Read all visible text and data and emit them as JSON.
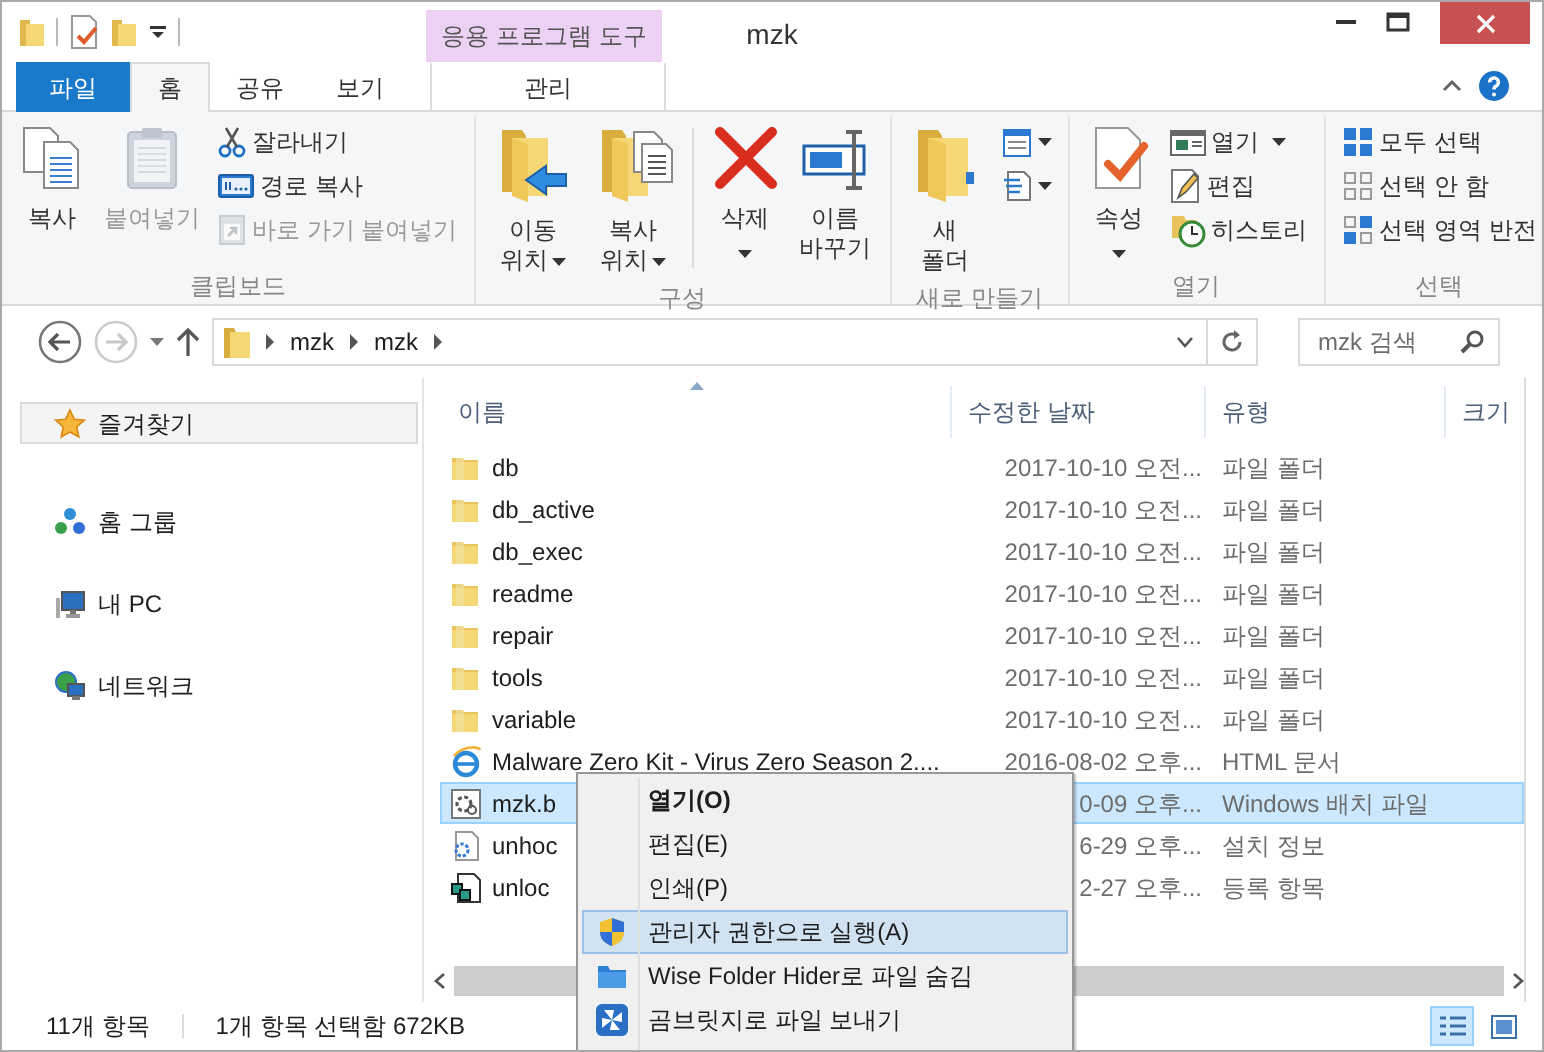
{
  "window": {
    "title": "mzk"
  },
  "contextual_tab_header": "응용 프로그램 도구",
  "ribbon_tabs": [
    {
      "label": "파일",
      "kind": "file",
      "selected": false
    },
    {
      "label": "홈",
      "kind": "tab",
      "selected": true
    },
    {
      "label": "공유",
      "kind": "tab",
      "selected": false
    },
    {
      "label": "보기",
      "kind": "tab",
      "selected": false
    },
    {
      "label": "관리",
      "kind": "contextual",
      "selected": false
    }
  ],
  "ribbon_groups": [
    {
      "label": "클립보드",
      "items": [
        {
          "kind": "large",
          "lines": [
            "복사"
          ],
          "dropdown": false,
          "disabled": false
        },
        {
          "kind": "large",
          "lines": [
            "붙여넣기"
          ],
          "dropdown": false,
          "disabled": true
        },
        {
          "kind": "column",
          "buttons": [
            {
              "label": "잘라내기",
              "dropdown": false,
              "disabled": false
            },
            {
              "label": "경로 복사",
              "dropdown": false,
              "disabled": false
            },
            {
              "label": "바로 가기 붙여넣기",
              "dropdown": false,
              "disabled": true
            }
          ]
        }
      ]
    },
    {
      "label": "구성",
      "items": [
        {
          "kind": "large",
          "lines": [
            "이동",
            "위치"
          ],
          "dropdown": true,
          "disabled": false
        },
        {
          "kind": "large",
          "lines": [
            "복사",
            "위치"
          ],
          "dropdown": true,
          "disabled": false
        },
        {
          "kind": "separator"
        },
        {
          "kind": "large",
          "lines": [
            "삭제"
          ],
          "dropdown": true,
          "disabled": false
        },
        {
          "kind": "large",
          "lines": [
            "이름",
            "바꾸기"
          ],
          "dropdown": false,
          "disabled": false
        }
      ]
    },
    {
      "label": "새로 만들기",
      "items": [
        {
          "kind": "large",
          "lines": [
            "새",
            "폴더"
          ],
          "dropdown": false,
          "disabled": false
        },
        {
          "kind": "column",
          "buttons": [
            {
              "dropdown": true,
              "disabled": false
            },
            {
              "dropdown": true,
              "disabled": false
            }
          ]
        }
      ]
    },
    {
      "label": "열기",
      "items": [
        {
          "kind": "large",
          "lines": [
            "속성"
          ],
          "dropdown": true,
          "disabled": false
        },
        {
          "kind": "column",
          "buttons": [
            {
              "label": "열기",
              "dropdown": true,
              "disabled": false
            },
            {
              "label": "편집",
              "dropdown": false,
              "disabled": false
            },
            {
              "label": "히스토리",
              "dropdown": false,
              "disabled": false
            }
          ]
        }
      ]
    },
    {
      "label": "선택",
      "items": [
        {
          "kind": "column",
          "buttons": [
            {
              "label": "모두 선택",
              "dropdown": false,
              "disabled": false
            },
            {
              "label": "선택 안 함",
              "dropdown": false,
              "disabled": false
            },
            {
              "label": "선택 영역 반전",
              "dropdown": false,
              "disabled": false
            }
          ]
        }
      ]
    }
  ],
  "address_bar": {
    "breadcrumbs": [
      "mzk",
      "mzk"
    ]
  },
  "search": {
    "placeholder": "mzk 검색"
  },
  "navigation_pane": [
    {
      "label": "즐겨찾기",
      "kind": "favorites",
      "selected": true
    },
    {
      "label": "홈 그룹",
      "kind": "homegroup",
      "selected": false
    },
    {
      "label": "내 PC",
      "kind": "pc",
      "selected": false
    },
    {
      "label": "네트워크",
      "kind": "network",
      "selected": false
    }
  ],
  "file_list": {
    "columns": [
      "이름",
      "수정한 날짜",
      "유형",
      "크기"
    ],
    "rows": [
      {
        "name": "db",
        "date": "2017-10-10 오전...",
        "type": "파일 폴더",
        "kind": "folder",
        "selected": false
      },
      {
        "name": "db_active",
        "date": "2017-10-10 오전...",
        "type": "파일 폴더",
        "kind": "folder",
        "selected": false
      },
      {
        "name": "db_exec",
        "date": "2017-10-10 오전...",
        "type": "파일 폴더",
        "kind": "folder",
        "selected": false
      },
      {
        "name": "readme",
        "date": "2017-10-10 오전...",
        "type": "파일 폴더",
        "kind": "folder",
        "selected": false
      },
      {
        "name": "repair",
        "date": "2017-10-10 오전...",
        "type": "파일 폴더",
        "kind": "folder",
        "selected": false
      },
      {
        "name": "tools",
        "date": "2017-10-10 오전...",
        "type": "파일 폴더",
        "kind": "folder",
        "selected": false
      },
      {
        "name": "variable",
        "date": "2017-10-10 오전...",
        "type": "파일 폴더",
        "kind": "folder",
        "selected": false
      },
      {
        "name": "Malware Zero Kit - Virus Zero Season 2....",
        "date": "2016-08-02 오후...",
        "type": "HTML 문서",
        "kind": "html",
        "selected": false
      },
      {
        "name": "mzk.b",
        "date": "0-09 오후...",
        "type": "Windows 배치 파일",
        "kind": "batch",
        "selected": true
      },
      {
        "name": "unhoc",
        "date": "6-29 오후...",
        "type": "설치 정보",
        "kind": "setup",
        "selected": false
      },
      {
        "name": "unloc",
        "date": "2-27 오후...",
        "type": "등록 항목",
        "kind": "registry",
        "selected": false
      }
    ]
  },
  "context_menu": [
    {
      "label": "열기(O)",
      "kind": "default",
      "selected": false
    },
    {
      "label": "편집(E)",
      "kind": "item",
      "selected": false
    },
    {
      "label": "인쇄(P)",
      "kind": "item",
      "selected": false
    },
    {
      "label": "관리자 권한으로 실행(A)",
      "kind": "shield",
      "selected": true
    },
    {
      "label": "Wise Folder Hider로 파일 숨김",
      "kind": "hider",
      "selected": false
    },
    {
      "label": "곰브릿지로 파일 보내기",
      "kind": "bridge",
      "selected": false
    }
  ],
  "status_bar": {
    "item_count": "11개 항목",
    "selection": "1개 항목 선택함 672KB",
    "views": [
      {
        "selected": true
      },
      {
        "selected": false
      }
    ]
  }
}
